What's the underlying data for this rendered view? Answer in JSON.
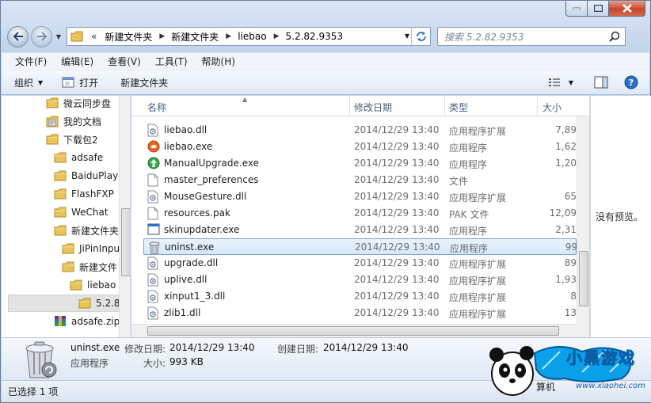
{
  "address": {
    "crumbs": [
      "新建文件夹",
      "新建文件夹",
      "liebao",
      "5.2.82.9353"
    ],
    "overflow": "«"
  },
  "search": {
    "placeholder": "搜索 5.2.82.9353"
  },
  "menu": [
    "文件(F)",
    "编辑(E)",
    "查看(V)",
    "工具(T)",
    "帮助(H)"
  ],
  "toolbar": {
    "organize": "组织",
    "open": "打开",
    "new_folder": "新建文件夹"
  },
  "tree": [
    {
      "label": "微云同步盘",
      "indent": 0,
      "icon": "folder-icon"
    },
    {
      "label": "我的文档",
      "indent": 0,
      "icon": "documents-icon"
    },
    {
      "label": "下载包2",
      "indent": 0,
      "icon": "folder-icon"
    },
    {
      "label": "adsafe",
      "indent": 1,
      "icon": "folder-icon"
    },
    {
      "label": "BaiduPlaye",
      "indent": 1,
      "icon": "folder-icon"
    },
    {
      "label": "FlashFXP",
      "indent": 1,
      "icon": "folder-icon"
    },
    {
      "label": "WeChat",
      "indent": 1,
      "icon": "folder-icon"
    },
    {
      "label": "新建文件夹",
      "indent": 1,
      "icon": "folder-icon"
    },
    {
      "label": "JiPinInpu",
      "indent": 2,
      "icon": "folder-icon"
    },
    {
      "label": "新建文件",
      "indent": 2,
      "icon": "folder-icon"
    },
    {
      "label": "liebao",
      "indent": 3,
      "icon": "folder-icon"
    },
    {
      "label": "5.2.8",
      "indent": 4,
      "icon": "folder-icon",
      "selected": true
    },
    {
      "label": "adsafe.zip",
      "indent": 1,
      "icon": "archive-icon"
    }
  ],
  "columns": {
    "name": "名称",
    "date": "修改日期",
    "type": "类型",
    "size": "大小"
  },
  "files": [
    {
      "name": "liebao.dll",
      "date": "2014/12/29 13:40",
      "type": "应用程序扩展",
      "size": "7,89",
      "icon": "dll-icon"
    },
    {
      "name": "liebao.exe",
      "date": "2014/12/29 13:40",
      "type": "应用程序",
      "size": "1,62",
      "icon": "liebao-app-icon"
    },
    {
      "name": "ManualUpgrade.exe",
      "date": "2014/12/29 13:40",
      "type": "应用程序",
      "size": "1,20",
      "icon": "upgrade-app-icon"
    },
    {
      "name": "master_preferences",
      "date": "2014/12/29 13:40",
      "type": "文件",
      "size": "",
      "icon": "file-icon"
    },
    {
      "name": "MouseGesture.dll",
      "date": "2014/12/29 13:40",
      "type": "应用程序扩展",
      "size": "65",
      "icon": "dll-icon"
    },
    {
      "name": "resources.pak",
      "date": "2014/12/29 13:40",
      "type": "PAK 文件",
      "size": "12,09",
      "icon": "file-icon"
    },
    {
      "name": "skinupdater.exe",
      "date": "2014/12/29 13:40",
      "type": "应用程序",
      "size": "2,31",
      "icon": "window-app-icon"
    },
    {
      "name": "uninst.exe",
      "date": "2014/12/29 13:40",
      "type": "应用程序",
      "size": "99",
      "icon": "trash-app-icon",
      "selected": true
    },
    {
      "name": "upgrade.dll",
      "date": "2014/12/29 13:40",
      "type": "应用程序扩展",
      "size": "89",
      "icon": "dll-icon"
    },
    {
      "name": "uplive.dll",
      "date": "2014/12/29 13:40",
      "type": "应用程序扩展",
      "size": "1,93",
      "icon": "dll-icon"
    },
    {
      "name": "xinput1_3.dll",
      "date": "2014/12/29 13:40",
      "type": "应用程序扩展",
      "size": "8",
      "icon": "dll-icon"
    },
    {
      "name": "zlib1.dll",
      "date": "2014/12/29 13:40",
      "type": "应用程序扩展",
      "size": "13",
      "icon": "dll-icon"
    }
  ],
  "preview": {
    "text": "没有预览。"
  },
  "details": {
    "name": "uninst.exe",
    "modified_label": "修改日期:",
    "modified": "2014/12/29 13:40",
    "created_label": "创建日期:",
    "created": "2014/12/29 13:40",
    "type": "应用程序",
    "size_label": "大小:",
    "size": "993 KB"
  },
  "status": {
    "text": "已选择 1 项"
  },
  "watermark": {
    "brand": "小黑游戏",
    "url": "www.xiaohei.com",
    "partial": "算机"
  }
}
